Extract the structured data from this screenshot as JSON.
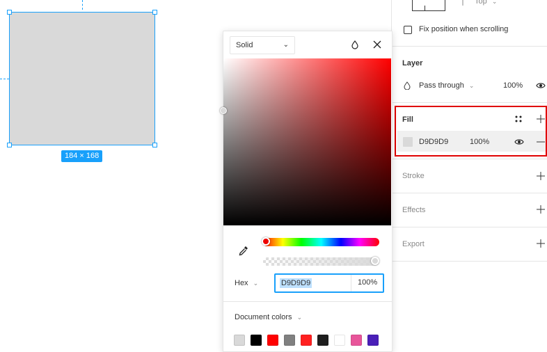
{
  "canvas": {
    "frame_fill": "#D9D9D9",
    "selection_color": "#18A0FB",
    "size_badge": "184 × 168"
  },
  "color_picker": {
    "paint_type": "Solid",
    "hue": "red",
    "color_mode": "Hex",
    "hex_value": "D9D9D9",
    "opacity": "100%",
    "document_colors_label": "Document colors",
    "document_colors": [
      "#D9D9D9",
      "#000000",
      "#FF0000",
      "#808080",
      "#FF2020",
      "#1E1E1E",
      "#FFFFFF",
      "#E8559A",
      "#4A1FB8"
    ]
  },
  "properties_panel": {
    "constraint_vertical": "Top",
    "fix_position_label": "Fix position when scrolling",
    "layer": {
      "title": "Layer",
      "blend_mode": "Pass through",
      "opacity": "100%"
    },
    "fill": {
      "title": "Fill",
      "hex": "D9D9D9",
      "opacity": "100%",
      "swatch_color": "#D9D9D9",
      "highlight_color": "#E00000"
    },
    "stroke_title": "Stroke",
    "effects_title": "Effects",
    "export_title": "Export"
  }
}
